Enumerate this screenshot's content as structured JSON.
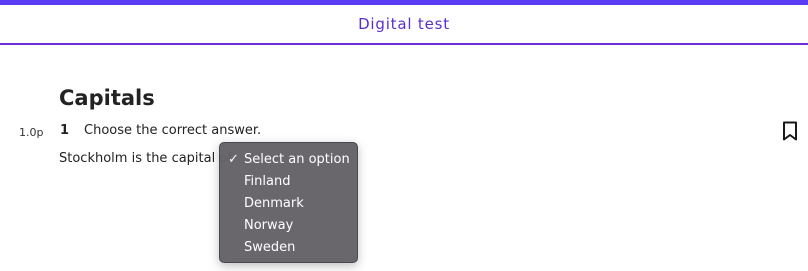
{
  "header": {
    "title": "Digital test",
    "accent_color": "#5b3cf5",
    "title_color": "#5a2fd0"
  },
  "section": {
    "title": "Capitals"
  },
  "question": {
    "points": "1.0p",
    "number": "1",
    "prompt": "Choose the correct answer.",
    "text": "Stockholm is the capital of",
    "bookmark_icon": "bookmark-icon"
  },
  "dropdown": {
    "selected_index": 0,
    "options": [
      {
        "label": "Select an option",
        "checked": true
      },
      {
        "label": "Finland",
        "checked": false
      },
      {
        "label": "Denmark",
        "checked": false
      },
      {
        "label": "Norway",
        "checked": false
      },
      {
        "label": "Sweden",
        "checked": false
      }
    ],
    "check_glyph": "✓",
    "background": "#646167"
  }
}
